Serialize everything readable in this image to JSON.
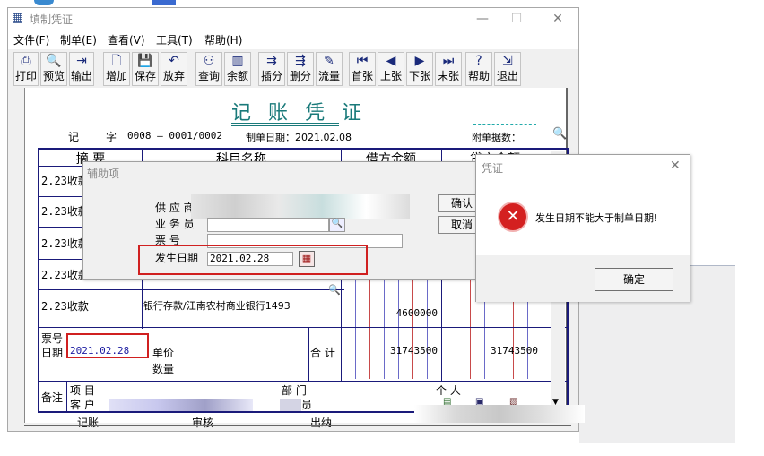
{
  "window": {
    "title": "填制凭证",
    "min": "—",
    "max": "☐",
    "close": "✕"
  },
  "menu": [
    "文件(F)",
    "制单(E)",
    "查看(V)",
    "工具(T)",
    "帮助(H)"
  ],
  "toolbar": [
    "打印",
    "预览",
    "输出",
    "增加",
    "保存",
    "放弃",
    "查询",
    "余额",
    "插分",
    "删分",
    "流量",
    "首张",
    "上张",
    "下张",
    "末张",
    "帮助",
    "退出"
  ],
  "voucher": {
    "title": "记 账 凭 证",
    "type_char1": "记",
    "type_char2": "字",
    "number": "0008 – 0001/0002",
    "date_label": "制单日期：2021.02.08",
    "attach_label": "附单据数：",
    "headers": {
      "summary": "摘 要",
      "account": "科目名称",
      "debit": "借方金额",
      "credit": "贷方金额"
    },
    "rows": [
      {
        "summary": "2.23收款",
        "account": "",
        "debit": "",
        "credit": ""
      },
      {
        "summary": "2.23收款",
        "account": "",
        "debit": "",
        "credit": ""
      },
      {
        "summary": "2.23收款",
        "account": "",
        "debit": "",
        "credit": ""
      },
      {
        "summary": "2.23收款",
        "account": "",
        "debit": "",
        "credit": ""
      },
      {
        "summary": "2.23收款",
        "account": "银行存款/江南农村商业银行1493",
        "debit": "4600000",
        "credit": ""
      }
    ],
    "footer": {
      "ticket_label": "票号",
      "date_label": "日期",
      "date_value": "2021.02.28",
      "unit_price_label": "单价",
      "qty_label": "数量",
      "total_label": "合 计",
      "total_debit": "31743500",
      "total_credit": "31743500",
      "note_label": "备注",
      "project_label": "项 目",
      "customer_label": "客 户",
      "dept_label": "部 门",
      "staff_label": "员",
      "person_label": "个 人"
    },
    "sign": {
      "bookkeeper": "记账",
      "review": "审核",
      "cashier": "出纳"
    }
  },
  "aux_dialog": {
    "title": "辅助项",
    "supplier_label": "供 应 商",
    "salesman_label": "业 务 员",
    "ticket_label": "票 号",
    "issue_date_label": "发生日期",
    "issue_date_value": "2021.02.28",
    "ok_label": "确认",
    "cancel_label": "取消"
  },
  "error_dialog": {
    "title": "凭证",
    "message": "发生日期不能大于制单日期!",
    "ok_label": "确定",
    "icon": "error-x-icon"
  }
}
